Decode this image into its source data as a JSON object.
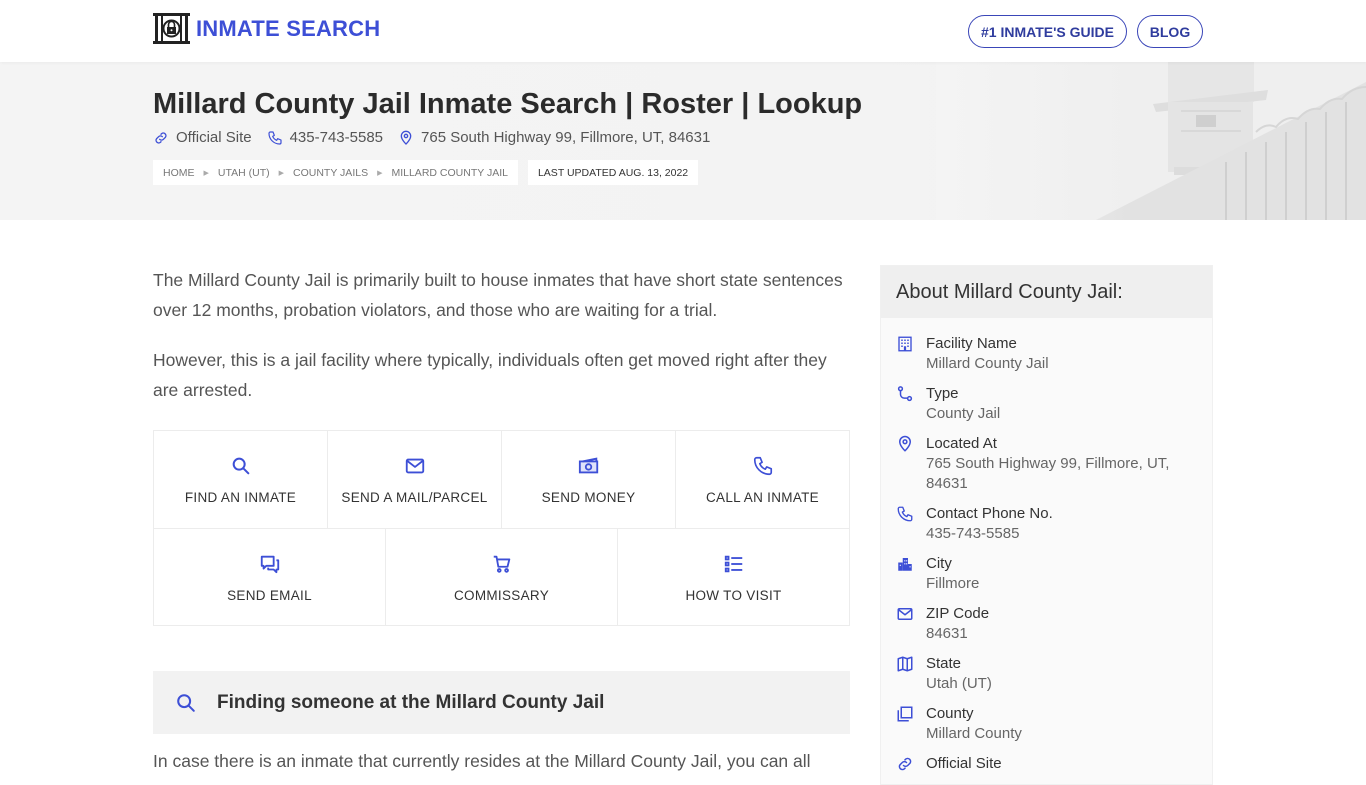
{
  "header": {
    "logo_text": "INMATE SEARCH",
    "nav": [
      {
        "label": "#1 INMATE'S GUIDE"
      },
      {
        "label": "BLOG"
      }
    ]
  },
  "hero": {
    "title": "Millard County Jail Inmate Search | Roster | Lookup",
    "official_site": "Official Site",
    "phone": "435-743-5585",
    "address": "765 South Highway 99, Fillmore, UT, 84631",
    "breadcrumbs": [
      "HOME",
      "UTAH (UT)",
      "COUNTY JAILS",
      "MILLARD COUNTY JAIL"
    ],
    "last_updated": "LAST UPDATED AUG. 13, 2022"
  },
  "main": {
    "intro": [
      "The Millard County Jail is primarily built to house inmates that have short state sentences over 12 months, probation violators, and those who are waiting for a trial.",
      "However, this is a jail facility where typically, individuals often get moved right after they are arrested."
    ],
    "actions": [
      {
        "label": "FIND AN INMATE",
        "icon": "search-icon"
      },
      {
        "label": "SEND A MAIL/PARCEL",
        "icon": "mail-icon"
      },
      {
        "label": "SEND MONEY",
        "icon": "money-icon"
      },
      {
        "label": "CALL AN INMATE",
        "icon": "phone-icon"
      },
      {
        "label": "SEND EMAIL",
        "icon": "chat-icon"
      },
      {
        "label": "COMMISSARY",
        "icon": "cart-icon"
      },
      {
        "label": "HOW TO VISIT",
        "icon": "list-icon"
      }
    ],
    "find_section": {
      "title": "Finding someone at the Millard County Jail",
      "text": "In case there is an inmate that currently resides at the Millard County Jail, you can all"
    }
  },
  "sidebar": {
    "title": "About Millard County Jail:",
    "items": [
      {
        "label": "Facility Name",
        "value": "Millard County Jail",
        "icon": "building-icon"
      },
      {
        "label": "Type",
        "value": "County Jail",
        "icon": "route-icon"
      },
      {
        "label": "Located At",
        "value": "765 South Highway 99, Fillmore, UT, 84631",
        "icon": "location-pin-icon"
      },
      {
        "label": "Contact Phone No.",
        "value": "435-743-5585",
        "icon": "phone-icon"
      },
      {
        "label": "City",
        "value": "Fillmore",
        "icon": "city-icon"
      },
      {
        "label": "ZIP Code",
        "value": "84631",
        "icon": "mail-icon"
      },
      {
        "label": "State",
        "value": "Utah (UT)",
        "icon": "map-icon"
      },
      {
        "label": "County",
        "value": "Millard County",
        "icon": "county-icon"
      },
      {
        "label": "Official Site",
        "value": "",
        "icon": "link-icon"
      }
    ]
  },
  "colors": {
    "accent": "#3d4fd6",
    "nav_border": "#3a46b8",
    "hero_bg": "#f4f4f4",
    "panel_head": "#efefef"
  }
}
